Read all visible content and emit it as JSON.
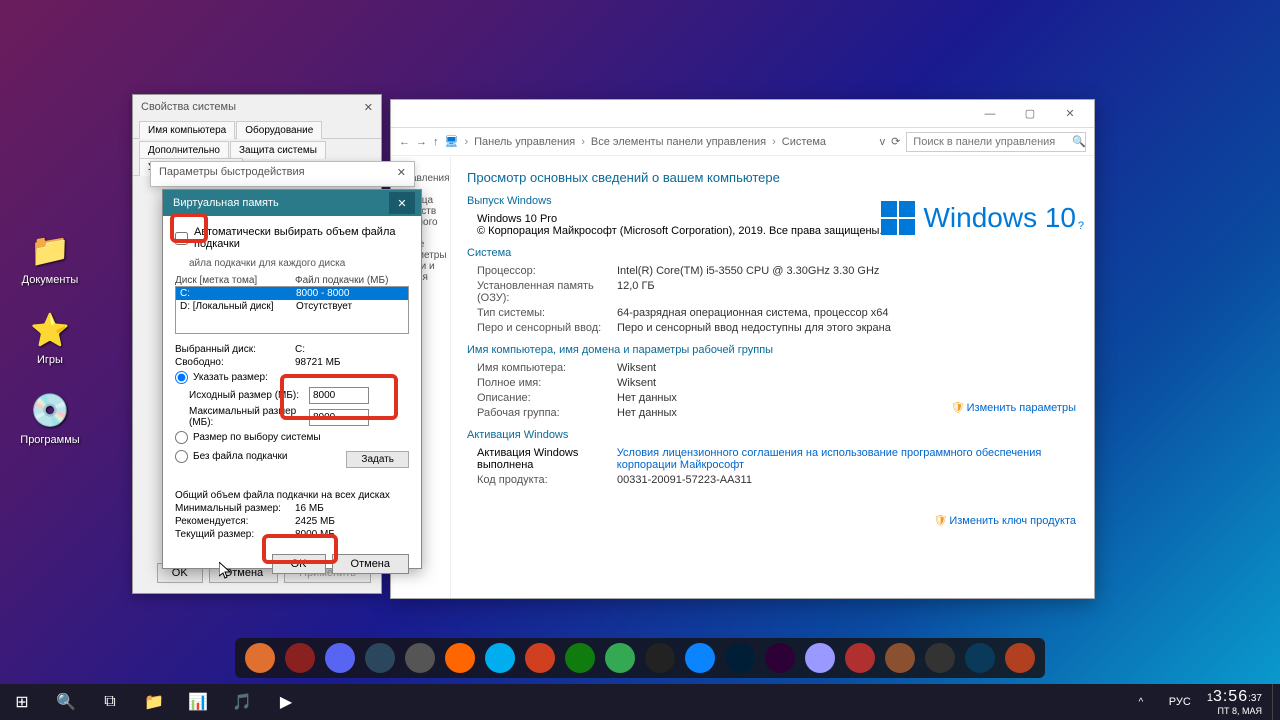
{
  "desktop": {
    "icons": [
      {
        "label": "Документы",
        "glyph": "📁"
      },
      {
        "label": "Игры",
        "glyph": "⭐"
      },
      {
        "label": "Программы",
        "glyph": "💿"
      }
    ]
  },
  "system_window": {
    "breadcrumb": [
      "Панель управления",
      "Все элементы панели управления",
      "Система"
    ],
    "search_placeholder": "Поиск в панели управления",
    "heading": "Просмотр основных сведений о вашем компьютере",
    "section_windows": "Выпуск Windows",
    "edition": "Windows 10 Pro",
    "copyright": "© Корпорация Майкрософт (Microsoft Corporation), 2019. Все права защищены.",
    "logo_text": "Windows 10",
    "section_system": "Система",
    "rows_system": [
      {
        "l": "Процессор:",
        "v": "Intel(R) Core(TM) i5-3550 CPU @ 3.30GHz   3.30 GHz"
      },
      {
        "l": "Установленная память (ОЗУ):",
        "v": "12,0 ГБ"
      },
      {
        "l": "Тип системы:",
        "v": "64-разрядная операционная система, процессор x64"
      },
      {
        "l": "Перо и сенсорный ввод:",
        "v": "Перо и сенсорный ввод недоступны для этого экрана"
      }
    ],
    "section_name": "Имя компьютера, имя домена и параметры рабочей группы",
    "rows_name": [
      {
        "l": "Имя компьютера:",
        "v": "Wiksent"
      },
      {
        "l": "Полное имя:",
        "v": "Wiksent"
      },
      {
        "l": "Описание:",
        "v": "Нет данных"
      },
      {
        "l": "Рабочая группа:",
        "v": "Нет данных"
      }
    ],
    "change_params": "Изменить параметры",
    "section_activation": "Активация Windows",
    "activation_status": "Активация Windows выполнена",
    "activation_link": "Условия лицензионного соглашения на использование программного обеспечения корпорации Майкрософт",
    "product_key_label": "Код продукта:",
    "product_key": "00331-20091-57223-AA311",
    "change_key": "Изменить ключ продукта",
    "side_note": "ли управления —\nтраница\nстройств\nаленного\nтемы\nльные параметры\nсности и\nивания"
  },
  "props_window": {
    "title": "Свойства системы",
    "tabs": [
      "Имя компьютера",
      "Оборудование",
      "Дополнительно",
      "Защита системы",
      "Удаленный доступ"
    ],
    "ok": "OK",
    "cancel": "Отмена",
    "apply": "Применить"
  },
  "perf_window": {
    "title": "Параметры быстродействия"
  },
  "vm_window": {
    "title": "Виртуальная память",
    "auto_check": "Автоматически выбирать объем файла подкачки",
    "sub_label": "айла подкачки для каждого диска",
    "hdr_drive": "Диск [метка тома]",
    "hdr_file": "Файл подкачки (МБ)",
    "drives": [
      {
        "d": "C:",
        "f": "8000 - 8000",
        "sel": true
      },
      {
        "d": "D:   [Локальный диск]",
        "f": "Отсутствует",
        "sel": false
      }
    ],
    "selected_label": "Выбранный диск:",
    "selected_value": "C:",
    "free_label": "Свободно:",
    "free_value": "98721 МБ",
    "radio_custom": "Указать размер:",
    "initial_label": "Исходный размер (МБ):",
    "initial_value": "8000",
    "max_label": "Максимальный размер (МБ):",
    "max_value": "8000",
    "radio_system": "Размер по выбору системы",
    "radio_none": "Без файла подкачки",
    "set_button": "Задать",
    "total_header": "Общий объем файла подкачки на всех дисках",
    "min_label": "Минимальный размер:",
    "min_value": "16 МБ",
    "rec_label": "Рекомендуется:",
    "rec_value": "2425 МБ",
    "cur_label": "Текущий размер:",
    "cur_value": "8000 МБ",
    "ok": "OK",
    "cancel": "Отмена"
  },
  "launcher_colors": [
    "#e07030",
    "#8b2020",
    "#5865f2",
    "#2a475e",
    "#555",
    "#ff6600",
    "#00aeef",
    "#d04020",
    "#107c10",
    "#34a853",
    "#222",
    "#0a84ff",
    "#001e36",
    "#2d0036",
    "#9999ff",
    "#b03030",
    "#8a5030",
    "#333",
    "#0a3a5a",
    "#b04020"
  ],
  "taskbar": {
    "time": "3:56",
    "sec": ":37",
    "date": "ПТ   8, МАЯ",
    "lang": "РУС"
  }
}
